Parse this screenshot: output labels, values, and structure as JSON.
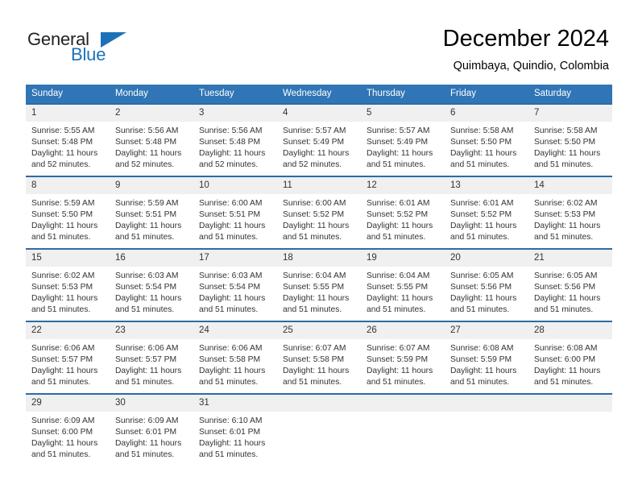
{
  "brand": {
    "name_part1": "General",
    "name_part2": "Blue",
    "flag_icon": "triangle-flag-icon"
  },
  "header": {
    "month_title": "December 2024",
    "location": "Quimbaya, Quindio, Colombia"
  },
  "colors": {
    "header_blue": "#3075b5",
    "row_border_blue": "#2b6ca8",
    "daynum_band": "#f0f0f0",
    "brand_blue": "#1b72b8"
  },
  "weekdays": [
    "Sunday",
    "Monday",
    "Tuesday",
    "Wednesday",
    "Thursday",
    "Friday",
    "Saturday"
  ],
  "weeks": [
    [
      {
        "day": "1",
        "sunrise": "Sunrise: 5:55 AM",
        "sunset": "Sunset: 5:48 PM",
        "daylight1": "Daylight: 11 hours",
        "daylight2": "and 52 minutes."
      },
      {
        "day": "2",
        "sunrise": "Sunrise: 5:56 AM",
        "sunset": "Sunset: 5:48 PM",
        "daylight1": "Daylight: 11 hours",
        "daylight2": "and 52 minutes."
      },
      {
        "day": "3",
        "sunrise": "Sunrise: 5:56 AM",
        "sunset": "Sunset: 5:48 PM",
        "daylight1": "Daylight: 11 hours",
        "daylight2": "and 52 minutes."
      },
      {
        "day": "4",
        "sunrise": "Sunrise: 5:57 AM",
        "sunset": "Sunset: 5:49 PM",
        "daylight1": "Daylight: 11 hours",
        "daylight2": "and 52 minutes."
      },
      {
        "day": "5",
        "sunrise": "Sunrise: 5:57 AM",
        "sunset": "Sunset: 5:49 PM",
        "daylight1": "Daylight: 11 hours",
        "daylight2": "and 51 minutes."
      },
      {
        "day": "6",
        "sunrise": "Sunrise: 5:58 AM",
        "sunset": "Sunset: 5:50 PM",
        "daylight1": "Daylight: 11 hours",
        "daylight2": "and 51 minutes."
      },
      {
        "day": "7",
        "sunrise": "Sunrise: 5:58 AM",
        "sunset": "Sunset: 5:50 PM",
        "daylight1": "Daylight: 11 hours",
        "daylight2": "and 51 minutes."
      }
    ],
    [
      {
        "day": "8",
        "sunrise": "Sunrise: 5:59 AM",
        "sunset": "Sunset: 5:50 PM",
        "daylight1": "Daylight: 11 hours",
        "daylight2": "and 51 minutes."
      },
      {
        "day": "9",
        "sunrise": "Sunrise: 5:59 AM",
        "sunset": "Sunset: 5:51 PM",
        "daylight1": "Daylight: 11 hours",
        "daylight2": "and 51 minutes."
      },
      {
        "day": "10",
        "sunrise": "Sunrise: 6:00 AM",
        "sunset": "Sunset: 5:51 PM",
        "daylight1": "Daylight: 11 hours",
        "daylight2": "and 51 minutes."
      },
      {
        "day": "11",
        "sunrise": "Sunrise: 6:00 AM",
        "sunset": "Sunset: 5:52 PM",
        "daylight1": "Daylight: 11 hours",
        "daylight2": "and 51 minutes."
      },
      {
        "day": "12",
        "sunrise": "Sunrise: 6:01 AM",
        "sunset": "Sunset: 5:52 PM",
        "daylight1": "Daylight: 11 hours",
        "daylight2": "and 51 minutes."
      },
      {
        "day": "13",
        "sunrise": "Sunrise: 6:01 AM",
        "sunset": "Sunset: 5:52 PM",
        "daylight1": "Daylight: 11 hours",
        "daylight2": "and 51 minutes."
      },
      {
        "day": "14",
        "sunrise": "Sunrise: 6:02 AM",
        "sunset": "Sunset: 5:53 PM",
        "daylight1": "Daylight: 11 hours",
        "daylight2": "and 51 minutes."
      }
    ],
    [
      {
        "day": "15",
        "sunrise": "Sunrise: 6:02 AM",
        "sunset": "Sunset: 5:53 PM",
        "daylight1": "Daylight: 11 hours",
        "daylight2": "and 51 minutes."
      },
      {
        "day": "16",
        "sunrise": "Sunrise: 6:03 AM",
        "sunset": "Sunset: 5:54 PM",
        "daylight1": "Daylight: 11 hours",
        "daylight2": "and 51 minutes."
      },
      {
        "day": "17",
        "sunrise": "Sunrise: 6:03 AM",
        "sunset": "Sunset: 5:54 PM",
        "daylight1": "Daylight: 11 hours",
        "daylight2": "and 51 minutes."
      },
      {
        "day": "18",
        "sunrise": "Sunrise: 6:04 AM",
        "sunset": "Sunset: 5:55 PM",
        "daylight1": "Daylight: 11 hours",
        "daylight2": "and 51 minutes."
      },
      {
        "day": "19",
        "sunrise": "Sunrise: 6:04 AM",
        "sunset": "Sunset: 5:55 PM",
        "daylight1": "Daylight: 11 hours",
        "daylight2": "and 51 minutes."
      },
      {
        "day": "20",
        "sunrise": "Sunrise: 6:05 AM",
        "sunset": "Sunset: 5:56 PM",
        "daylight1": "Daylight: 11 hours",
        "daylight2": "and 51 minutes."
      },
      {
        "day": "21",
        "sunrise": "Sunrise: 6:05 AM",
        "sunset": "Sunset: 5:56 PM",
        "daylight1": "Daylight: 11 hours",
        "daylight2": "and 51 minutes."
      }
    ],
    [
      {
        "day": "22",
        "sunrise": "Sunrise: 6:06 AM",
        "sunset": "Sunset: 5:57 PM",
        "daylight1": "Daylight: 11 hours",
        "daylight2": "and 51 minutes."
      },
      {
        "day": "23",
        "sunrise": "Sunrise: 6:06 AM",
        "sunset": "Sunset: 5:57 PM",
        "daylight1": "Daylight: 11 hours",
        "daylight2": "and 51 minutes."
      },
      {
        "day": "24",
        "sunrise": "Sunrise: 6:06 AM",
        "sunset": "Sunset: 5:58 PM",
        "daylight1": "Daylight: 11 hours",
        "daylight2": "and 51 minutes."
      },
      {
        "day": "25",
        "sunrise": "Sunrise: 6:07 AM",
        "sunset": "Sunset: 5:58 PM",
        "daylight1": "Daylight: 11 hours",
        "daylight2": "and 51 minutes."
      },
      {
        "day": "26",
        "sunrise": "Sunrise: 6:07 AM",
        "sunset": "Sunset: 5:59 PM",
        "daylight1": "Daylight: 11 hours",
        "daylight2": "and 51 minutes."
      },
      {
        "day": "27",
        "sunrise": "Sunrise: 6:08 AM",
        "sunset": "Sunset: 5:59 PM",
        "daylight1": "Daylight: 11 hours",
        "daylight2": "and 51 minutes."
      },
      {
        "day": "28",
        "sunrise": "Sunrise: 6:08 AM",
        "sunset": "Sunset: 6:00 PM",
        "daylight1": "Daylight: 11 hours",
        "daylight2": "and 51 minutes."
      }
    ],
    [
      {
        "day": "29",
        "sunrise": "Sunrise: 6:09 AM",
        "sunset": "Sunset: 6:00 PM",
        "daylight1": "Daylight: 11 hours",
        "daylight2": "and 51 minutes."
      },
      {
        "day": "30",
        "sunrise": "Sunrise: 6:09 AM",
        "sunset": "Sunset: 6:01 PM",
        "daylight1": "Daylight: 11 hours",
        "daylight2": "and 51 minutes."
      },
      {
        "day": "31",
        "sunrise": "Sunrise: 6:10 AM",
        "sunset": "Sunset: 6:01 PM",
        "daylight1": "Daylight: 11 hours",
        "daylight2": "and 51 minutes."
      },
      {
        "day": "",
        "sunrise": "",
        "sunset": "",
        "daylight1": "",
        "daylight2": ""
      },
      {
        "day": "",
        "sunrise": "",
        "sunset": "",
        "daylight1": "",
        "daylight2": ""
      },
      {
        "day": "",
        "sunrise": "",
        "sunset": "",
        "daylight1": "",
        "daylight2": ""
      },
      {
        "day": "",
        "sunrise": "",
        "sunset": "",
        "daylight1": "",
        "daylight2": ""
      }
    ]
  ]
}
